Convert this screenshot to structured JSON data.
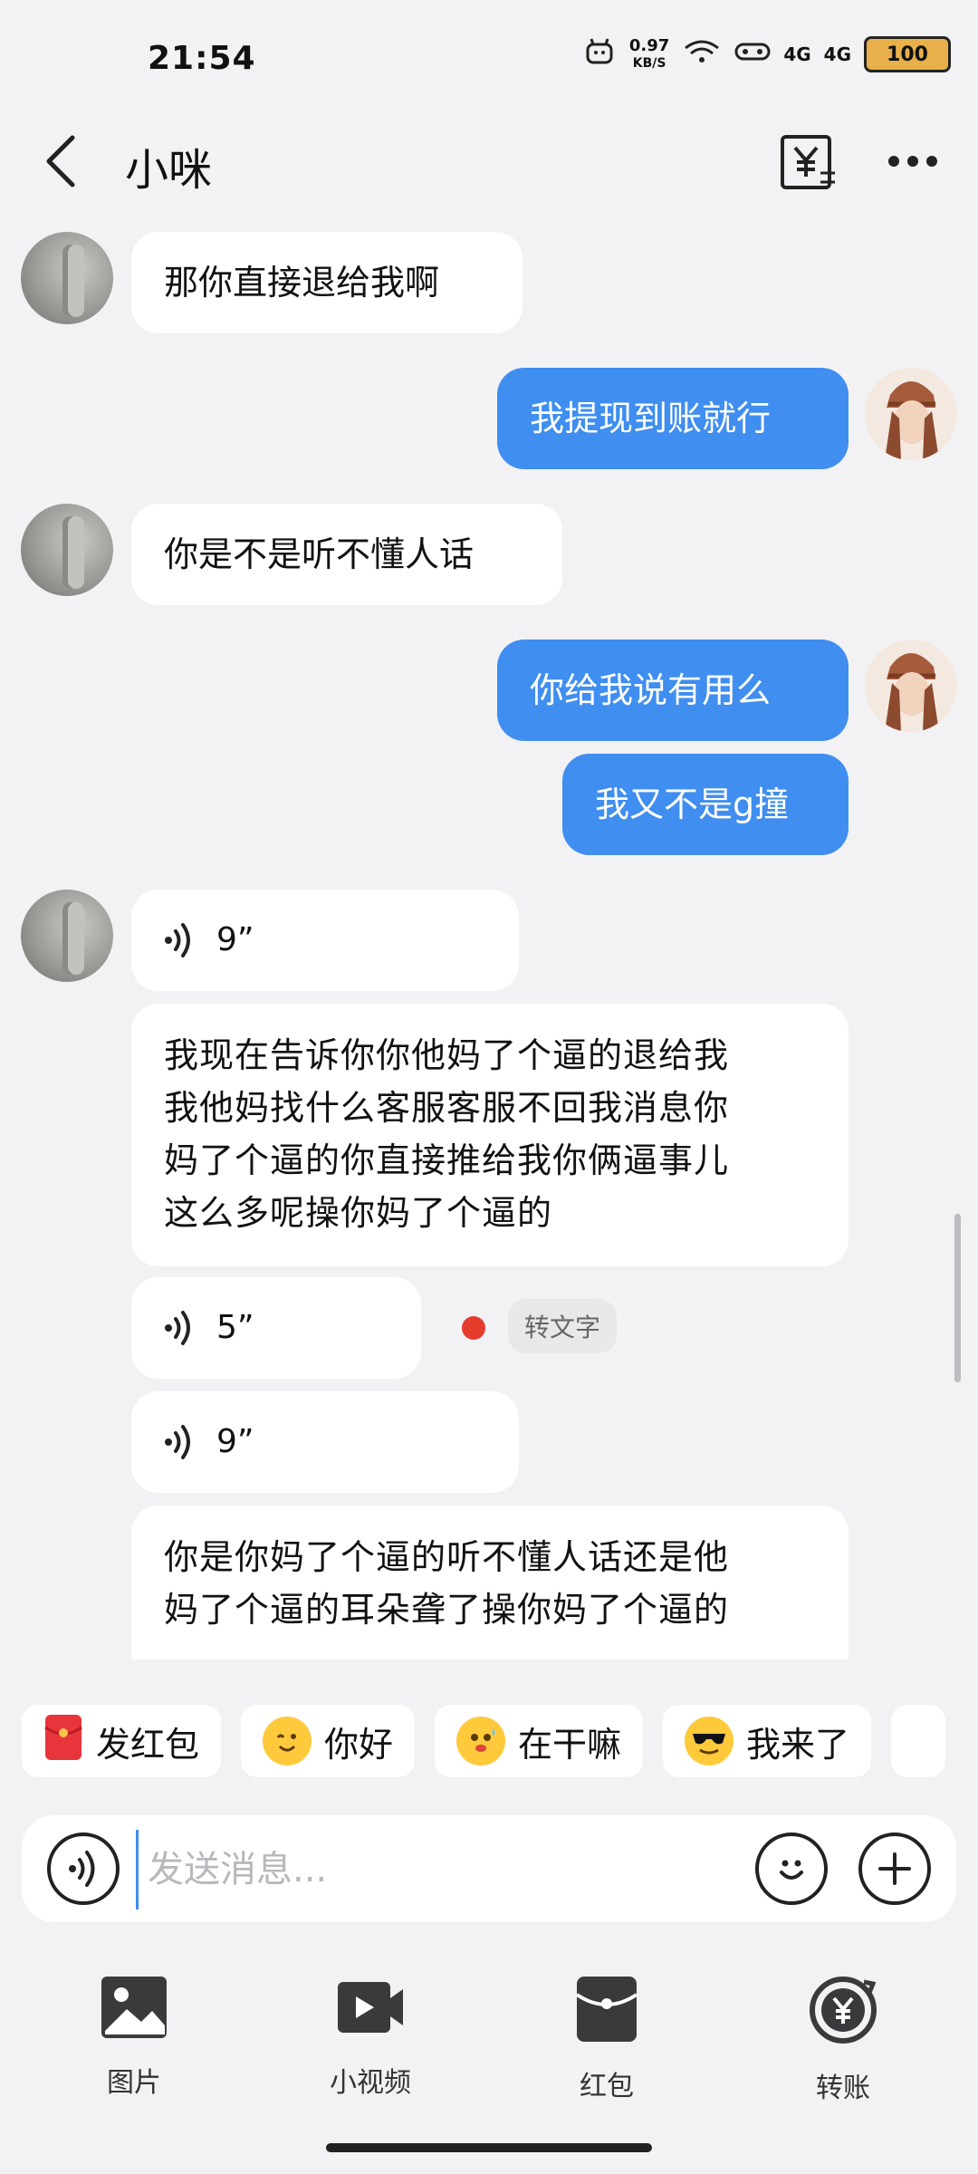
{
  "status_bar": {
    "time": "21:54",
    "net_speed": "0.97",
    "net_unit": "KB/S",
    "signal1": "4G",
    "signal2": "4G",
    "battery": "100"
  },
  "header": {
    "title": "小咪",
    "back_icon": "chevron-left-icon",
    "transfer_icon": "yuan-transfer-icon",
    "more_icon": "more-icon"
  },
  "messages": [
    {
      "side": "in",
      "type": "text",
      "text": "那你直接退给我啊"
    },
    {
      "side": "out",
      "type": "text",
      "text": "我提现到账就行"
    },
    {
      "side": "in",
      "type": "text",
      "text": "你是不是听不懂人话"
    },
    {
      "side": "out",
      "type": "text",
      "text": "你给我说有用么"
    },
    {
      "side": "out",
      "type": "text",
      "text": "我又不是g撞"
    },
    {
      "side": "in",
      "type": "voice",
      "duration": "9”"
    },
    {
      "side": "in",
      "type": "text",
      "lines": [
        "我现在告诉你你他妈了个逼的退给我",
        "我他妈找什么客服客服不回我消息你",
        "妈了个逼的你直接推给我你俩逼事儿",
        "这么多呢操你妈了个逼的"
      ]
    },
    {
      "side": "in",
      "type": "voice",
      "duration": "5”",
      "unread": true,
      "to_text": "转文字"
    },
    {
      "side": "in",
      "type": "voice",
      "duration": "9”"
    },
    {
      "side": "in",
      "type": "text",
      "lines": [
        "你是你妈了个逼的听不懂人话还是他",
        "妈了个逼的耳朵聋了操你妈了个逼的"
      ]
    }
  ],
  "quick_replies": [
    {
      "label": "发红包",
      "icon": "red-envelope-icon"
    },
    {
      "label": "你好",
      "icon": "wink-emoji-icon"
    },
    {
      "label": "在干嘛",
      "icon": "sweat-emoji-icon"
    },
    {
      "label": "我来了",
      "icon": "sunglasses-emoji-icon"
    }
  ],
  "input": {
    "placeholder": "发送消息..."
  },
  "toolbar": [
    {
      "label": "图片",
      "icon": "image-icon"
    },
    {
      "label": "小视频",
      "icon": "video-icon"
    },
    {
      "label": "红包",
      "icon": "red-packet-icon"
    },
    {
      "label": "转账",
      "icon": "transfer-icon"
    }
  ]
}
